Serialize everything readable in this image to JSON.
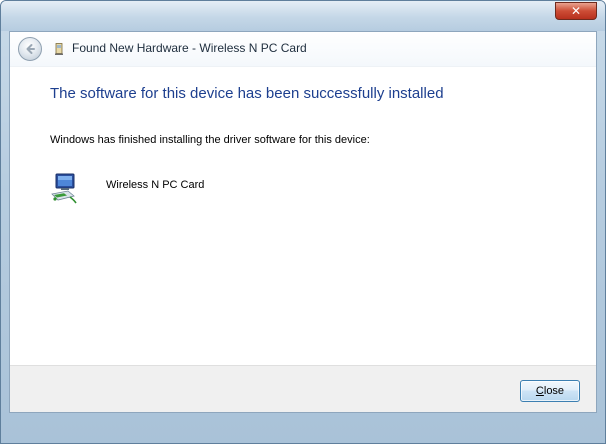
{
  "window": {
    "close_glyph": "✕"
  },
  "header": {
    "title": "Found New Hardware - Wireless N PC Card",
    "back_icon": "back-arrow-icon",
    "wizard_icon": "hardware-wizard-icon"
  },
  "main": {
    "heading": "The software for this device has been successfully installed",
    "info": "Windows has finished installing the driver software for this device:",
    "device": {
      "icon": "network-adapter-icon",
      "name": "Wireless N PC Card"
    }
  },
  "footer": {
    "close_mnemonic": "C",
    "close_rest": "lose"
  },
  "colors": {
    "heading": "#1d3f8f",
    "accent": "#3c7fb1"
  }
}
